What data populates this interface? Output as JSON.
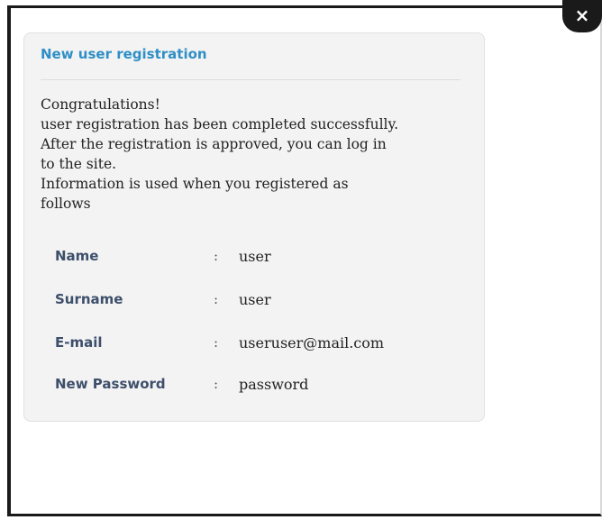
{
  "dialog": {
    "close_label": "×",
    "title": "New user registration",
    "message_lines": [
      "Congratulations!",
      "user registration has been completed successfully.",
      "After the registration is approved, you can log in",
      "to the site.",
      "Information is used when you registered as",
      "follows"
    ],
    "separator": ":",
    "fields": [
      {
        "label": "Name",
        "value": "user"
      },
      {
        "label": "Surname",
        "value": "user"
      },
      {
        "label": "E-mail",
        "value": "useruser@mail.com"
      },
      {
        "label": "New Password",
        "value": "password"
      }
    ]
  },
  "colors": {
    "title": "#2f8fc6",
    "label": "#3d4f6b",
    "panel_bg": "#f3f3f3",
    "frame": "#1a1a1a"
  }
}
